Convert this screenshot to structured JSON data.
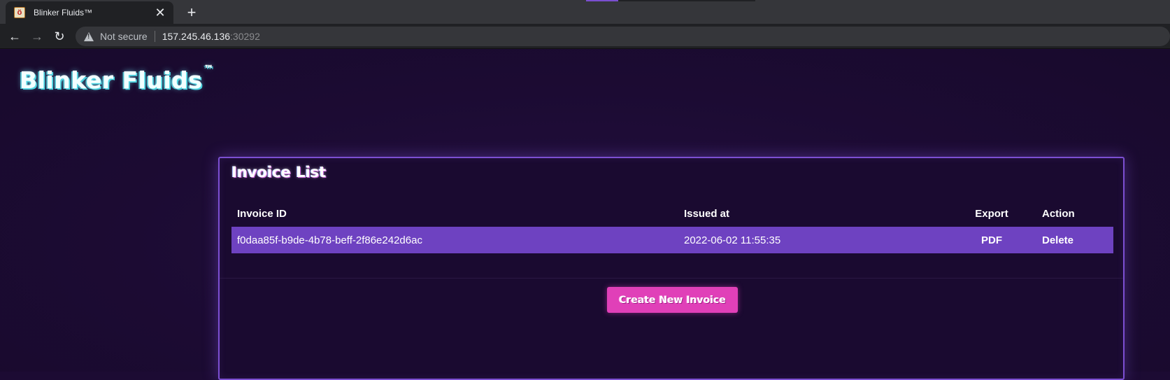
{
  "browser": {
    "tab_title": "Blinker Fluids™",
    "tab_favicon": "favicon-icon",
    "url_warning": "Not secure",
    "url_host": "157.245.46.136",
    "url_port": ":30292",
    "icons": {
      "close": "✕",
      "new_tab": "+",
      "back": "←",
      "forward": "→",
      "reload": "↻"
    }
  },
  "header": {
    "brand": "Blinker Fluids",
    "brand_mark": "™"
  },
  "invoice_panel": {
    "title": "Invoice List",
    "columns": {
      "id": "Invoice ID",
      "issued": "Issued at",
      "export": "Export",
      "action": "Action"
    },
    "rows": [
      {
        "id": "f0daa85f-b9de-4b78-beff-2f86e242d6ac",
        "issued": "2022-06-02 11:55:35",
        "export": "PDF",
        "action": "Delete"
      }
    ],
    "create_button": "Create New Invoice"
  },
  "colors": {
    "page_bg": "#1c0b33",
    "panel_border": "#7c4fd2",
    "row_highlight": "#6e42c1",
    "button_pink": "#e040b8",
    "brand_glow": "#4ad3e0"
  }
}
